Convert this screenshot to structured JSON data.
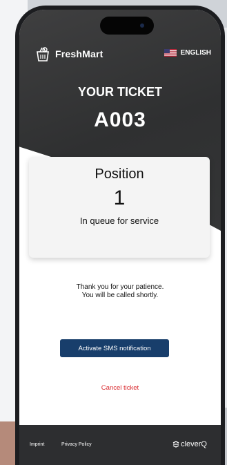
{
  "app": {
    "brand_name": "FreshMart",
    "brand_icon": "shopping-basket-icon",
    "language": "ENGLISH",
    "language_icon": "us-flag-icon"
  },
  "ticket": {
    "title": "YOUR TICKET",
    "number": "A003"
  },
  "position_card": {
    "label": "Position",
    "value": "1",
    "status": "In queue for service"
  },
  "message": {
    "line1": "Thank you for your patience.",
    "line2": "You will be called shortly."
  },
  "actions": {
    "sms_button": "Activate SMS notification",
    "cancel_link": "Cancel ticket"
  },
  "footer": {
    "imprint": "Imprint",
    "privacy": "Privacy Policy",
    "provider": "cleverQ",
    "provider_icon": "cleverq-logo-icon"
  },
  "colors": {
    "header_bg": "#333435",
    "primary_button": "#183e6b",
    "cancel_text": "#d9282d",
    "footer_bg": "#2d2e30"
  }
}
